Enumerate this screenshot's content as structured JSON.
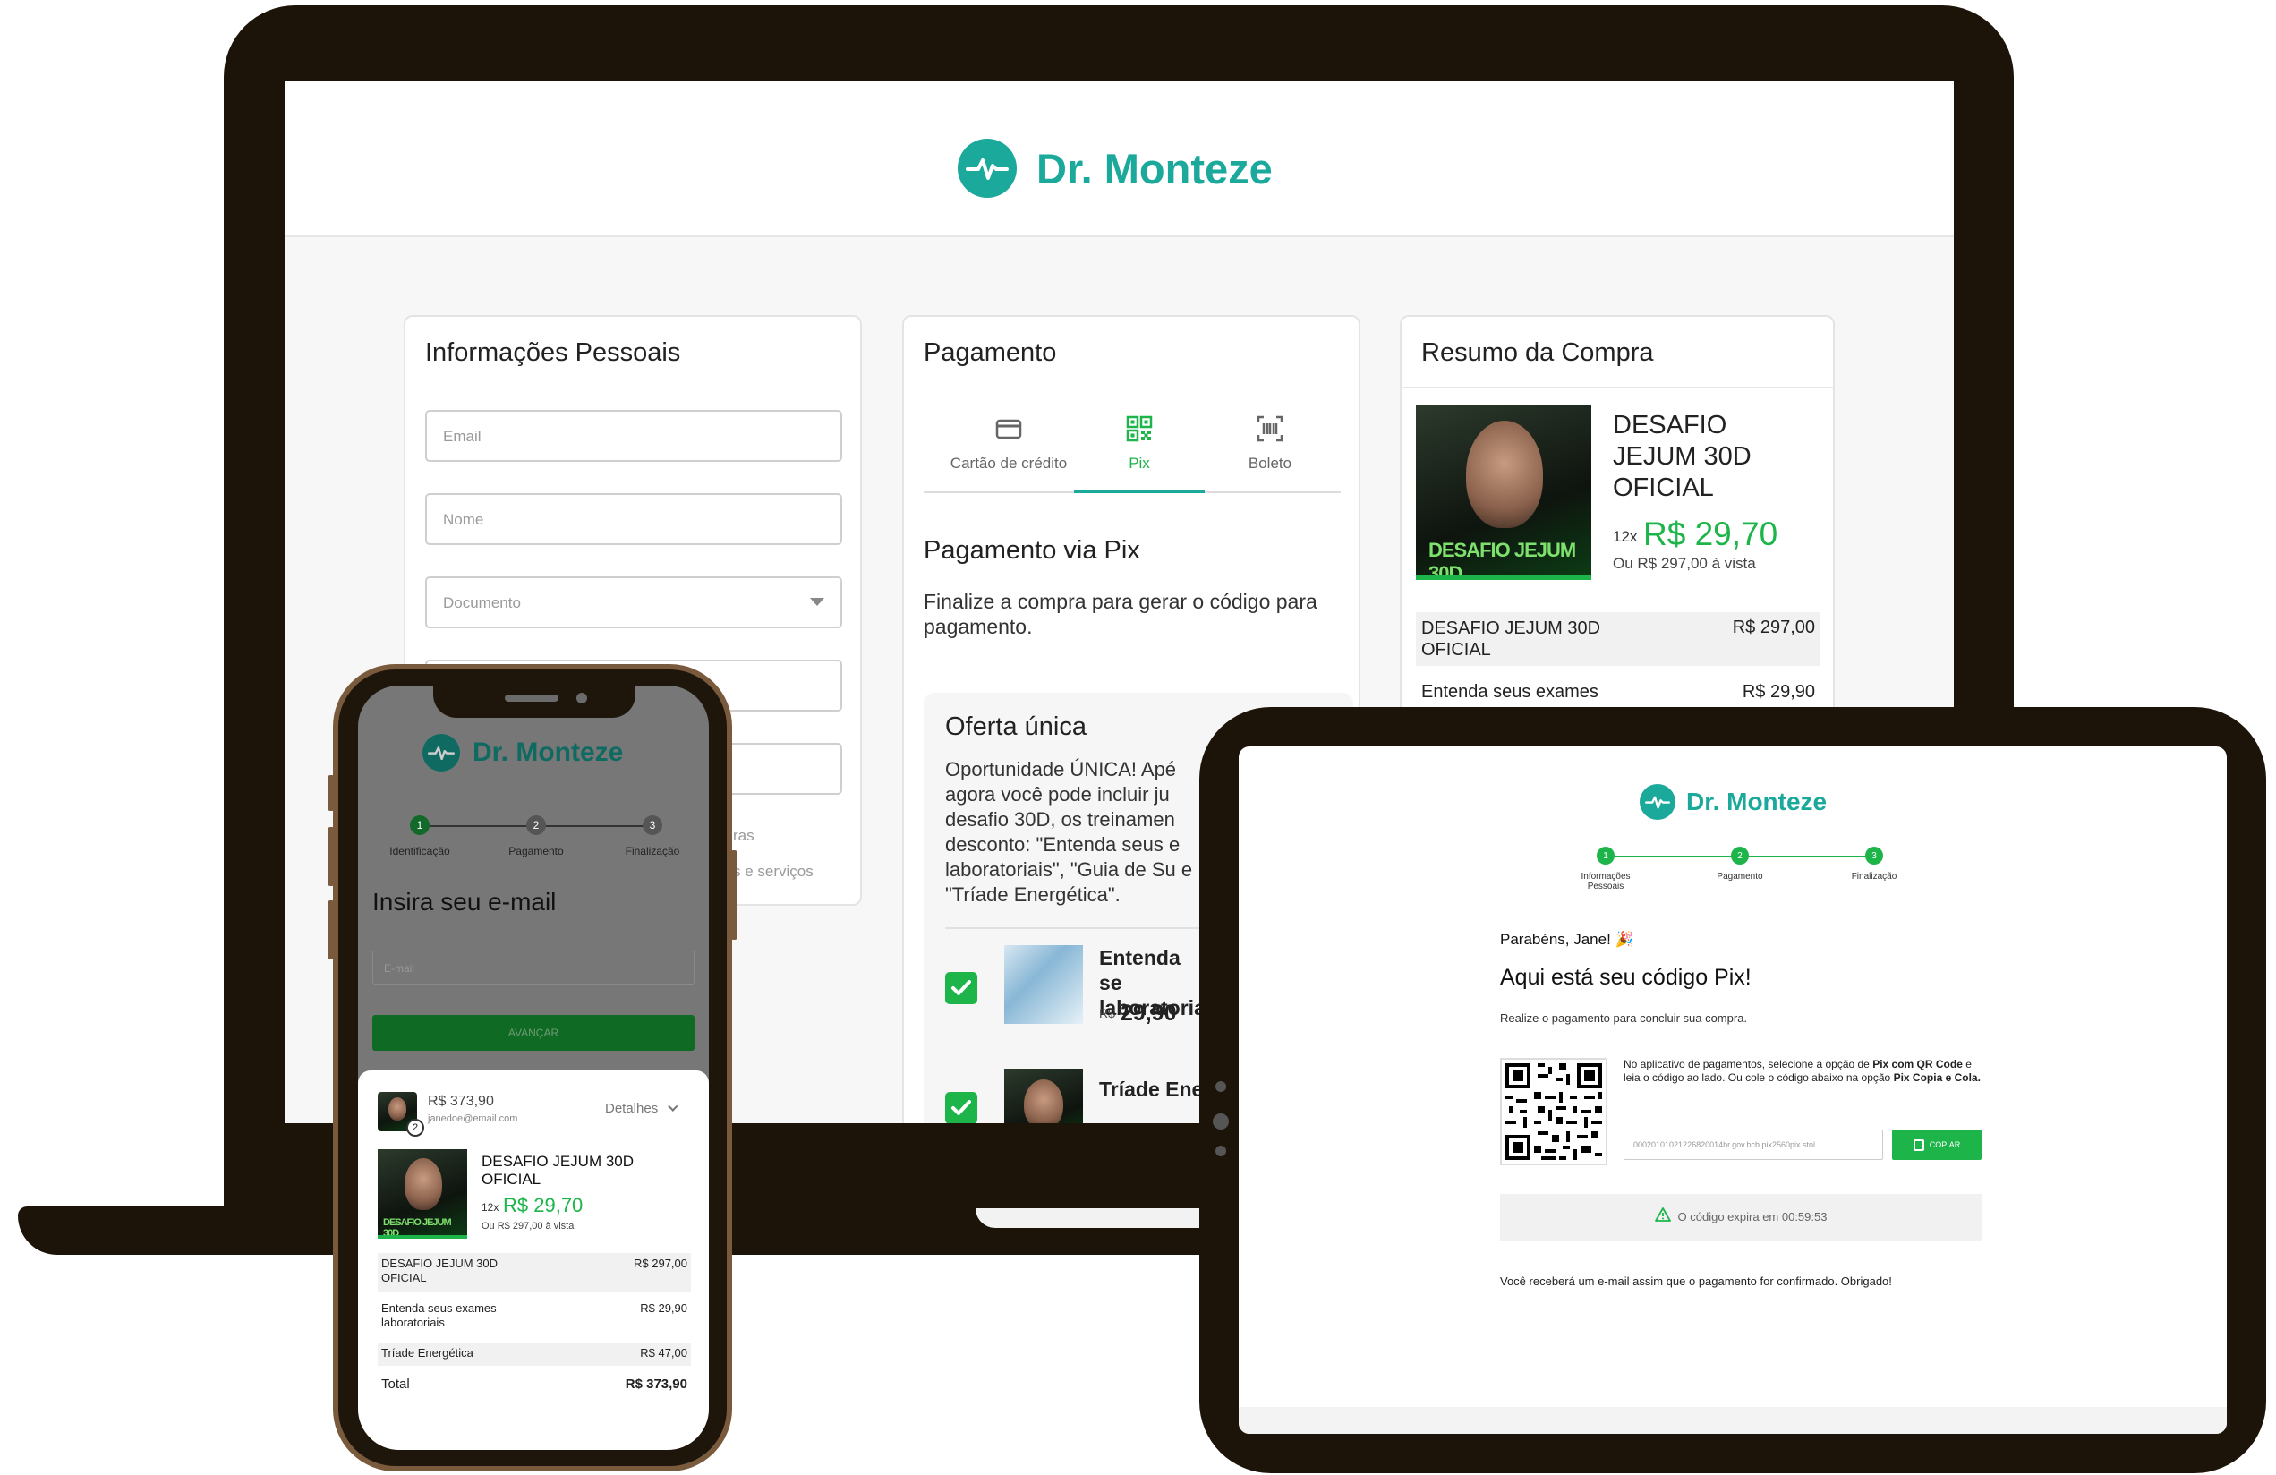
{
  "brand": {
    "name": "Dr. Monteze",
    "color": "#1aa99b",
    "accent_green": "#1db54a"
  },
  "laptop": {
    "personal": {
      "title": "Informações Pessoais",
      "email_placeholder": "Email",
      "name_placeholder": "Nome",
      "document_placeholder": "Documento",
      "link1_partial": "ras",
      "link2_partial": "s e serviços"
    },
    "payment": {
      "title": "Pagamento",
      "tabs": [
        {
          "label": "Cartão de crédito",
          "icon": "credit-card-icon"
        },
        {
          "label": "Pix",
          "icon": "qr-code-icon"
        },
        {
          "label": "Boleto",
          "icon": "barcode-icon"
        }
      ],
      "pix_title": "Pagamento via Pix",
      "pix_desc": "Finalize a compra para gerar o código para pagamento.",
      "offer_title": "Oferta única",
      "offer_text": "Oportunidade ÚNICA! Apé agora você pode incluir ju desafio 30D, os treinamen desconto: \"Entenda seus e laboratoriais\", \"Guia de Su e \"Tríade Energética\".",
      "offer_items": [
        {
          "title": "Entenda se laboratoria",
          "currency": "R$",
          "price": "29,90"
        },
        {
          "title": "Tríade Ene"
        }
      ]
    },
    "summary": {
      "title": "Resumo da Compra",
      "product_title": "DESAFIO JEJUM 30D OFICIAL",
      "installments": "12x",
      "installment_price": "R$ 29,70",
      "cash_price": "Ou R$ 297,00 à vista",
      "thumb_text": "DESAFIO JEJUM 30D",
      "lines": [
        {
          "label": "DESAFIO JEJUM 30D OFICIAL",
          "value": "R$ 297,00"
        },
        {
          "label": "Entenda seus exames",
          "value": "R$ 29,90"
        }
      ]
    }
  },
  "phone": {
    "steps": [
      "Identificação",
      "Pagamento",
      "Finalização"
    ],
    "step_numbers": [
      "1",
      "2",
      "3"
    ],
    "heading": "Insira seu e-mail",
    "email_placeholder": "E-mail",
    "button": "AVANÇAR",
    "total": "R$ 373,90",
    "email": "janedoe@email.com",
    "badge": "2",
    "details": "Detalhes",
    "product_title": "DESAFIO JEJUM 30D OFICIAL",
    "installments": "12x",
    "installment_price": "R$ 29,70",
    "cash_price": "Ou R$ 297,00 à vista",
    "thumb_text": "DESAFIO JEJUM 30D",
    "lines": [
      {
        "label": "DESAFIO JEJUM 30D OFICIAL",
        "value": "R$ 297,00"
      },
      {
        "label": "Entenda seus exames laboratoriais",
        "value": "R$ 29,90"
      },
      {
        "label": "Tríade Energética",
        "value": "R$ 47,00"
      }
    ],
    "total_label": "Total",
    "total_value": "R$ 373,90"
  },
  "tablet": {
    "steps": [
      "Informações Pessoais",
      "Pagamento",
      "Finalização"
    ],
    "step_numbers": [
      "1",
      "2",
      "3"
    ],
    "greeting": "Parabéns, Jane! 🎉",
    "heading": "Aqui está seu código Pix!",
    "sub": "Realize o pagamento para concluir sua compra.",
    "instr_1": "No aplicativo de pagamentos, selecione a opção de ",
    "instr_b1": "Pix com QR Code",
    "instr_2": " e leia o código ao lado. Ou cole o código abaixo na opção ",
    "instr_b2": "Pix Copia e Cola.",
    "code": "00020101021226820014br.gov.bcb.pix2560pix.stol",
    "copy_button": "COPIAR",
    "expires": "O código expira em 00:59:53",
    "footer": "Você receberá um e-mail assim que o pagamento for confirmado. Obrigado!"
  }
}
